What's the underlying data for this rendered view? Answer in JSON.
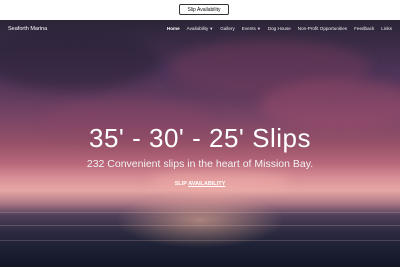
{
  "topbar": {
    "availability_button": "Slip Availability"
  },
  "header": {
    "brand": "Seaforth Marina",
    "nav": [
      {
        "label": "Home",
        "active": true,
        "dropdown": false
      },
      {
        "label": "Availability",
        "active": false,
        "dropdown": true
      },
      {
        "label": "Gallery",
        "active": false,
        "dropdown": false
      },
      {
        "label": "Events",
        "active": false,
        "dropdown": true
      },
      {
        "label": "Dog House",
        "active": false,
        "dropdown": false
      },
      {
        "label": "Non-Profit Opportunities",
        "active": false,
        "dropdown": false
      },
      {
        "label": "Feedback",
        "active": false,
        "dropdown": false
      },
      {
        "label": "Links",
        "active": false,
        "dropdown": false
      }
    ]
  },
  "hero": {
    "title": "35' - 30' - 25' Slips",
    "subtitle": "232 Convenient slips in the heart of Mission Bay.",
    "link_prefix": "SLIP",
    "link_underlined": "AVAILABILITY"
  }
}
